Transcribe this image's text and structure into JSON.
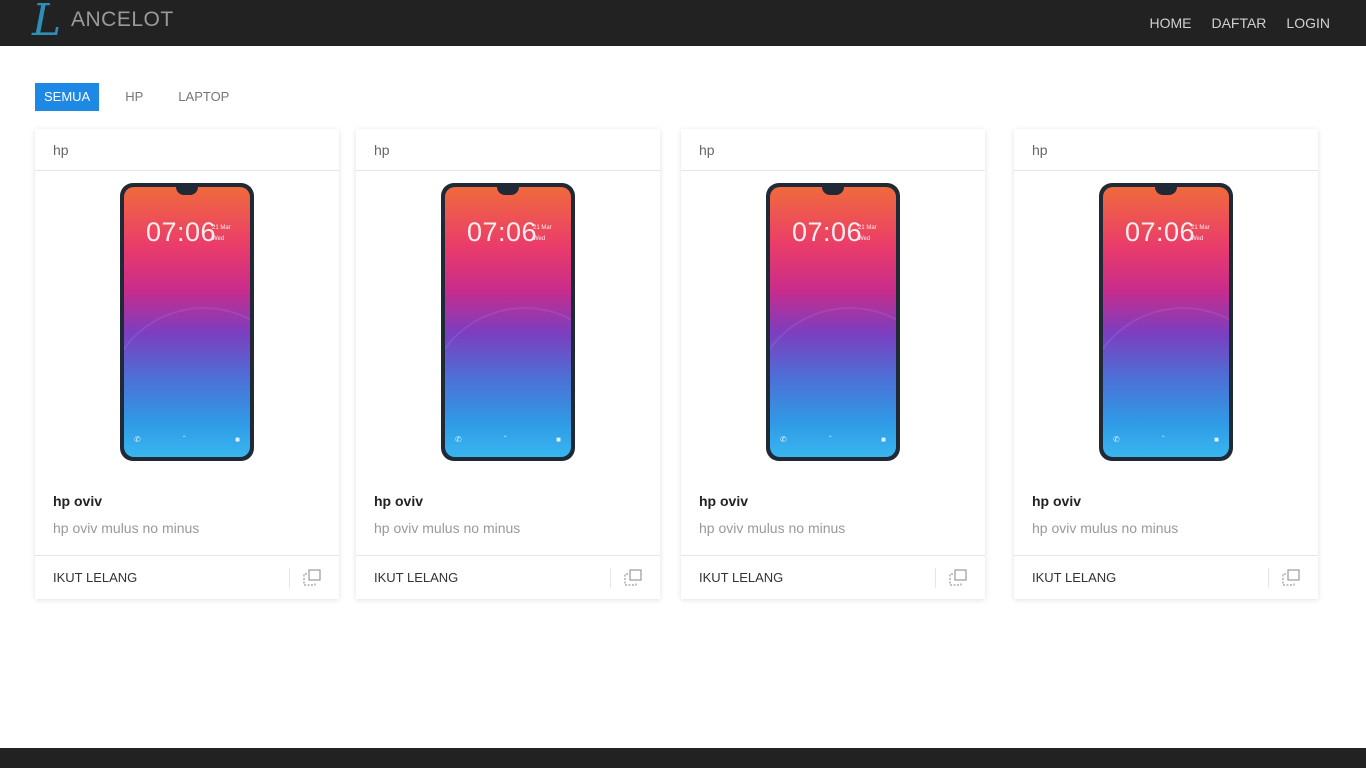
{
  "brand": {
    "initial": "L",
    "name": "ANCELOT"
  },
  "nav": {
    "items": [
      "HOME",
      "DAFTAR",
      "LOGIN"
    ]
  },
  "filters": {
    "items": [
      "SEMUA",
      "HP",
      "LAPTOP"
    ],
    "active": "SEMUA"
  },
  "colors": {
    "accent": "#1e88e5",
    "navbar": "#222222",
    "logo": "#2d8fb8"
  },
  "products": [
    {
      "category": "hp",
      "title": "hp oviv",
      "description": "hp oviv mulus no minus",
      "action_label": "IKUT LELANG",
      "action_icon": "copy-icon",
      "image": {
        "clock": "07:06",
        "date": "21 Mar",
        "day": "Wed"
      }
    },
    {
      "category": "hp",
      "title": "hp oviv",
      "description": "hp oviv mulus no minus",
      "action_label": "IKUT LELANG",
      "action_icon": "copy-icon",
      "image": {
        "clock": "07:06",
        "date": "21 Mar",
        "day": "Wed"
      }
    },
    {
      "category": "hp",
      "title": "hp oviv",
      "description": "hp oviv mulus no minus",
      "action_label": "IKUT LELANG",
      "action_icon": "copy-icon",
      "image": {
        "clock": "07:06",
        "date": "21 Mar",
        "day": "Wed"
      }
    },
    {
      "category": "hp",
      "title": "hp oviv",
      "description": "hp oviv mulus no minus",
      "action_label": "IKUT LELANG",
      "action_icon": "copy-icon",
      "image": {
        "clock": "07:06",
        "date": "21 Mar",
        "day": "Wed"
      }
    }
  ]
}
